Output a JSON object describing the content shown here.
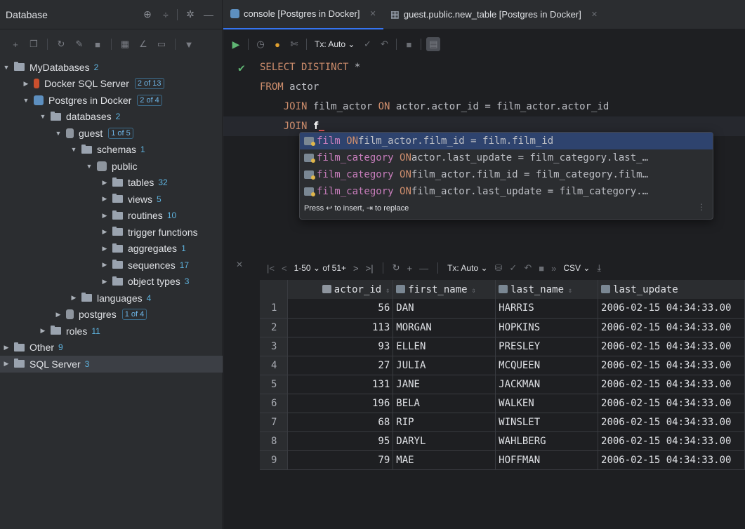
{
  "left": {
    "title": "Database",
    "tree": [
      {
        "label": "MyDatabases",
        "count": "2"
      },
      {
        "label": "Docker SQL Server",
        "badge": "2 of 13"
      },
      {
        "label": "Postgres in Docker",
        "badge": "2 of 4"
      },
      {
        "label": "databases",
        "count": "2"
      },
      {
        "label": "guest",
        "badge": "1 of 5"
      },
      {
        "label": "schemas",
        "count": "1"
      },
      {
        "label": "public"
      },
      {
        "label": "tables",
        "count": "32"
      },
      {
        "label": "views",
        "count": "5"
      },
      {
        "label": "routines",
        "count": "10"
      },
      {
        "label": "trigger functions"
      },
      {
        "label": "aggregates",
        "count": "1"
      },
      {
        "label": "sequences",
        "count": "17"
      },
      {
        "label": "object types",
        "count": "3"
      },
      {
        "label": "languages",
        "count": "4"
      },
      {
        "label": "postgres",
        "badge": "1 of 4"
      },
      {
        "label": "roles",
        "count": "11"
      },
      {
        "label": "Other",
        "count": "9"
      },
      {
        "label": "SQL Server",
        "count": "3"
      }
    ]
  },
  "tabs": [
    {
      "label": "console [Postgres in Docker]"
    },
    {
      "label": "guest.public.new_table [Postgres in Docker]"
    }
  ],
  "editor": {
    "tx_label": "Tx: Auto",
    "lines": {
      "l1_kw": "SELECT DISTINCT",
      "l1_rest": " *",
      "l2_kw": "FROM",
      "l2_rest": " actor",
      "l3_kw": "JOIN",
      "l3_a": " film_actor ",
      "l3_on": "ON",
      "l3_b": " actor.actor_id = film_actor.actor_id",
      "l4_kw": "JOIN",
      "l4_rest": " f"
    }
  },
  "autocomplete": {
    "items": [
      {
        "table": "film",
        "on": "ON",
        "cond": " film_actor.film_id = film.film_id"
      },
      {
        "table": "film_category",
        "on": "ON",
        "cond": " actor.last_update = film_category.last_…"
      },
      {
        "table": "film_category",
        "on": "ON",
        "cond": " film_actor.film_id = film_category.film…"
      },
      {
        "table": "film_category",
        "on": "ON",
        "cond": " film_actor.last_update = film_category.…"
      }
    ],
    "hint": "Press ↩ to insert, ⇥ to replace"
  },
  "results": {
    "range": "1-50",
    "of": "of 51+",
    "tx": "Tx: Auto",
    "export": "CSV",
    "columns": [
      "actor_id",
      "first_name",
      "last_name",
      "last_update"
    ],
    "rows": [
      [
        "1",
        "56",
        "DAN",
        "HARRIS",
        "2006-02-15 04:34:33.00"
      ],
      [
        "2",
        "113",
        "MORGAN",
        "HOPKINS",
        "2006-02-15 04:34:33.00"
      ],
      [
        "3",
        "93",
        "ELLEN",
        "PRESLEY",
        "2006-02-15 04:34:33.00"
      ],
      [
        "4",
        "27",
        "JULIA",
        "MCQUEEN",
        "2006-02-15 04:34:33.00"
      ],
      [
        "5",
        "131",
        "JANE",
        "JACKMAN",
        "2006-02-15 04:34:33.00"
      ],
      [
        "6",
        "196",
        "BELA",
        "WALKEN",
        "2006-02-15 04:34:33.00"
      ],
      [
        "7",
        "68",
        "RIP",
        "WINSLET",
        "2006-02-15 04:34:33.00"
      ],
      [
        "8",
        "95",
        "DARYL",
        "WAHLBERG",
        "2006-02-15 04:34:33.00"
      ],
      [
        "9",
        "79",
        "MAE",
        "HOFFMAN",
        "2006-02-15 04:34:33.00"
      ]
    ]
  }
}
